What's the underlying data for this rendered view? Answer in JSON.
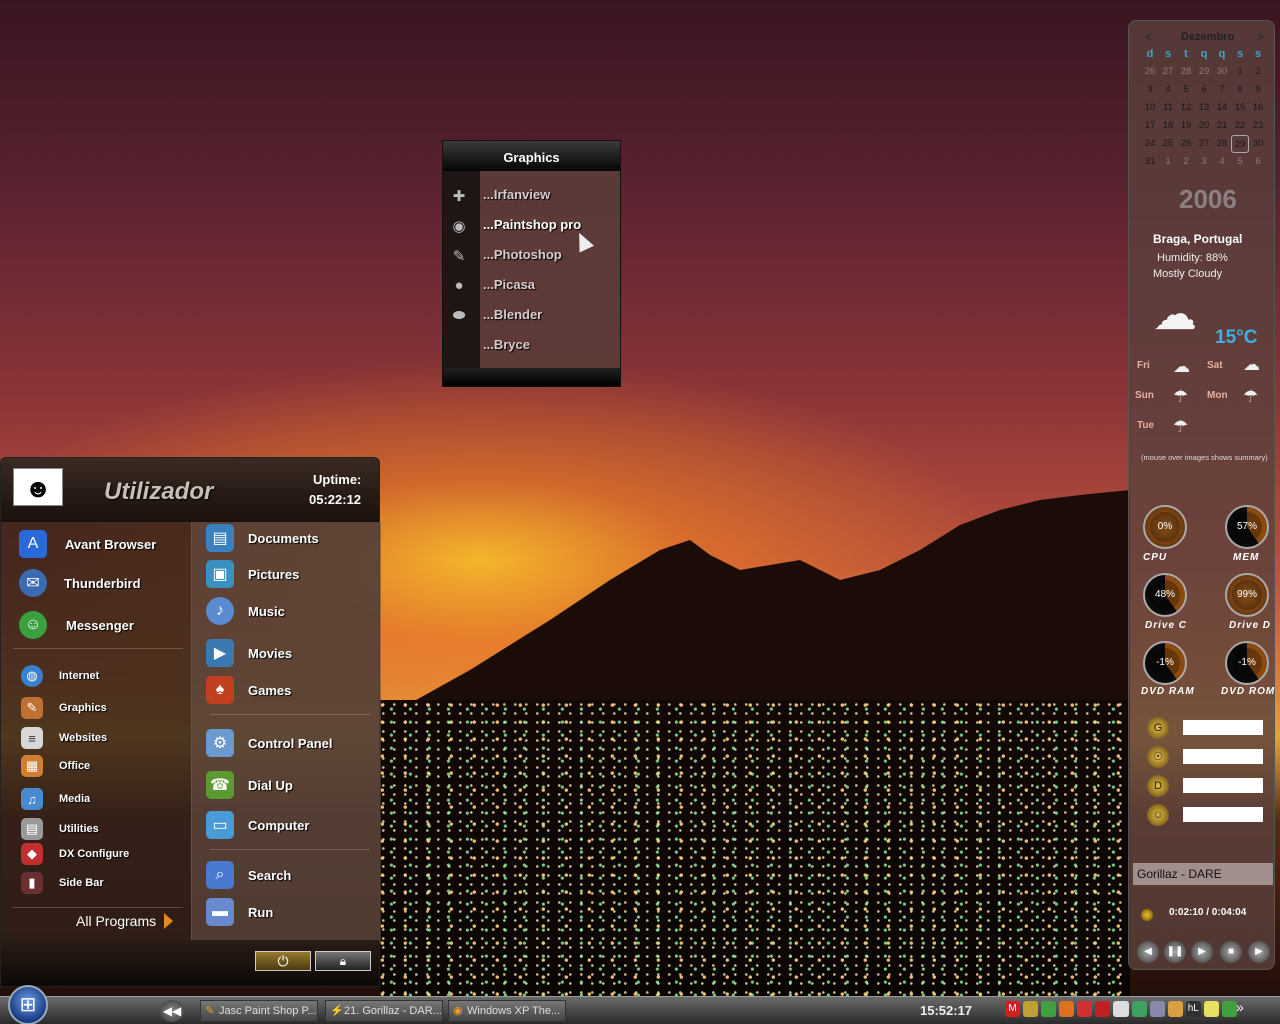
{
  "graphics_menu": {
    "title": "Graphics",
    "items": [
      {
        "label": "...Irfanview",
        "icon": "puzzle-icon"
      },
      {
        "label": "...Paintshop pro",
        "icon": "paint-icon"
      },
      {
        "label": "...Photoshop",
        "icon": "feather-icon"
      },
      {
        "label": "...Picasa",
        "icon": "picasa-icon"
      },
      {
        "label": "...Blender",
        "icon": "blender-icon"
      },
      {
        "label": "...Bryce",
        "icon": "bryce-icon"
      }
    ]
  },
  "start_menu": {
    "username": "Utilizador",
    "uptime_label": "Uptime:",
    "uptime": "05:22:12",
    "pinned": [
      {
        "label": "Avant Browser",
        "icon": "avant-browser-icon",
        "color": "#2a6ad8"
      },
      {
        "label": "Thunderbird",
        "icon": "thunderbird-icon",
        "color": "#3a6ab0"
      },
      {
        "label": "Messenger",
        "icon": "messenger-icon",
        "color": "#3aa040"
      }
    ],
    "categories": [
      {
        "label": "Internet",
        "icon": "globe-icon",
        "color": "#3a80d0"
      },
      {
        "label": "Graphics",
        "icon": "brushes-icon",
        "color": "#c07030"
      },
      {
        "label": "Websites",
        "icon": "document-icon",
        "color": "#d8d8d8"
      },
      {
        "label": "Office",
        "icon": "office-icon",
        "color": "#d08030"
      },
      {
        "label": "Media",
        "icon": "media-icon",
        "color": "#4a8ad0"
      },
      {
        "label": "Utilities",
        "icon": "utilities-icon",
        "color": "#9a9a9a"
      },
      {
        "label": "DX Configure",
        "icon": "dx-icon",
        "color": "#c03030"
      },
      {
        "label": "Side Bar",
        "icon": "sidebar-icon",
        "color": "#6a3030"
      }
    ],
    "all_programs": "All Programs",
    "places": [
      {
        "label": "Documents",
        "icon": "documents-icon",
        "color": "#3a80c0"
      },
      {
        "label": "Pictures",
        "icon": "pictures-icon",
        "color": "#3a90c0"
      },
      {
        "label": "Music",
        "icon": "music-icon",
        "color": "#5a8ad0"
      },
      {
        "label": "Movies",
        "icon": "movies-icon",
        "color": "#3a7ab0"
      },
      {
        "label": "Games",
        "icon": "games-icon",
        "color": "#c04020"
      },
      {
        "label": "Control Panel",
        "icon": "control-panel-icon",
        "color": "#6a9ad0"
      },
      {
        "label": "Dial Up",
        "icon": "dial-up-icon",
        "color": "#5a9a30"
      },
      {
        "label": "Computer",
        "icon": "computer-icon",
        "color": "#4a9ad8"
      },
      {
        "label": "Search",
        "icon": "search-icon",
        "color": "#4a7ad0"
      },
      {
        "label": "Run",
        "icon": "run-icon",
        "color": "#6a8ad0"
      }
    ],
    "power_icon": "power-icon",
    "lock_icon": "lock-icon"
  },
  "taskbar": {
    "tasks": [
      {
        "label": "Jasc Paint Shop P...",
        "icon": "paintshop-icon"
      },
      {
        "label": "21. Gorillaz - DAR...",
        "icon": "winamp-icon"
      },
      {
        "label": "Windows XP The...",
        "icon": "firefox-icon"
      }
    ],
    "clock": "15:52:17",
    "tray": [
      {
        "icon": "m-icon",
        "color": "#d02020",
        "text": "M"
      },
      {
        "icon": "pen-icon",
        "color": "#c0a030",
        "text": ""
      },
      {
        "icon": "grid-icon",
        "color": "#40a040",
        "text": ""
      },
      {
        "icon": "firefox-tray-icon",
        "color": "#e07020",
        "text": ""
      },
      {
        "icon": "antivirus-icon",
        "color": "#d03030",
        "text": ""
      },
      {
        "icon": "red-icon",
        "color": "#c02020",
        "text": ""
      },
      {
        "icon": "chess-icon",
        "color": "#ddd",
        "text": ""
      },
      {
        "icon": "network-icon",
        "color": "#40a060",
        "text": ""
      },
      {
        "icon": "wrench-icon",
        "color": "#8888aa",
        "text": ""
      },
      {
        "icon": "volume-icon",
        "color": "#d8a040",
        "text": ""
      },
      {
        "icon": "hl-icon",
        "color": "#303030",
        "text": "hL"
      },
      {
        "icon": "notes-icon",
        "color": "#e8e060",
        "text": ""
      },
      {
        "icon": "flag-icon",
        "color": "#40a040",
        "text": ""
      }
    ],
    "more": "»"
  },
  "sidebar": {
    "calendar": {
      "month": "Dezembro",
      "prev": "<",
      "next": ">",
      "weekdays": [
        "d",
        "s",
        "t",
        "q",
        "q",
        "s",
        "s"
      ],
      "weeks": [
        [
          "26",
          "27",
          "28",
          "29",
          "30",
          "1",
          "2"
        ],
        [
          "3",
          "4",
          "5",
          "6",
          "7",
          "8",
          "9"
        ],
        [
          "10",
          "11",
          "12",
          "13",
          "14",
          "15",
          "16"
        ],
        [
          "17",
          "18",
          "19",
          "20",
          "21",
          "22",
          "23"
        ],
        [
          "24",
          "25",
          "26",
          "27",
          "28",
          "29",
          "30"
        ],
        [
          "31",
          "1",
          "2",
          "3",
          "4",
          "5",
          "6"
        ]
      ],
      "today": "29",
      "year": "2006"
    },
    "weather": {
      "location": "Braga, Portugal",
      "humidity": "Humidity: 88%",
      "condition": "Mostly Cloudy",
      "temp": "15°C",
      "forecast": [
        {
          "day": "Fri",
          "icon": "partly-cloudy-icon"
        },
        {
          "day": "Sat",
          "icon": "cloudy-icon"
        },
        {
          "day": "Sun",
          "icon": "rain-icon"
        },
        {
          "day": "Mon",
          "icon": "rain-icon"
        },
        {
          "day": "Tue",
          "icon": "showers-icon"
        }
      ],
      "note": "(mouse over images shows summary)"
    },
    "meters": [
      {
        "label": "CPU",
        "value": "0%"
      },
      {
        "label": "MEM",
        "value": "57%"
      },
      {
        "label": "Drive C",
        "value": "48%"
      },
      {
        "label": "Drive D",
        "value": "99%"
      },
      {
        "label": "DVD RAM",
        "value": "-1%"
      },
      {
        "label": "DVD ROM",
        "value": "-1%"
      }
    ],
    "quick_icons": [
      "google-icon",
      "search-engine-icon",
      "dictionary-icon",
      "weather-search-icon"
    ],
    "media": {
      "title": "Gorillaz - DARE",
      "time": "0:02:10 / 0:04:04",
      "controls": [
        "previous-icon",
        "pause-icon",
        "play-icon",
        "stop-icon",
        "next-icon"
      ]
    }
  }
}
